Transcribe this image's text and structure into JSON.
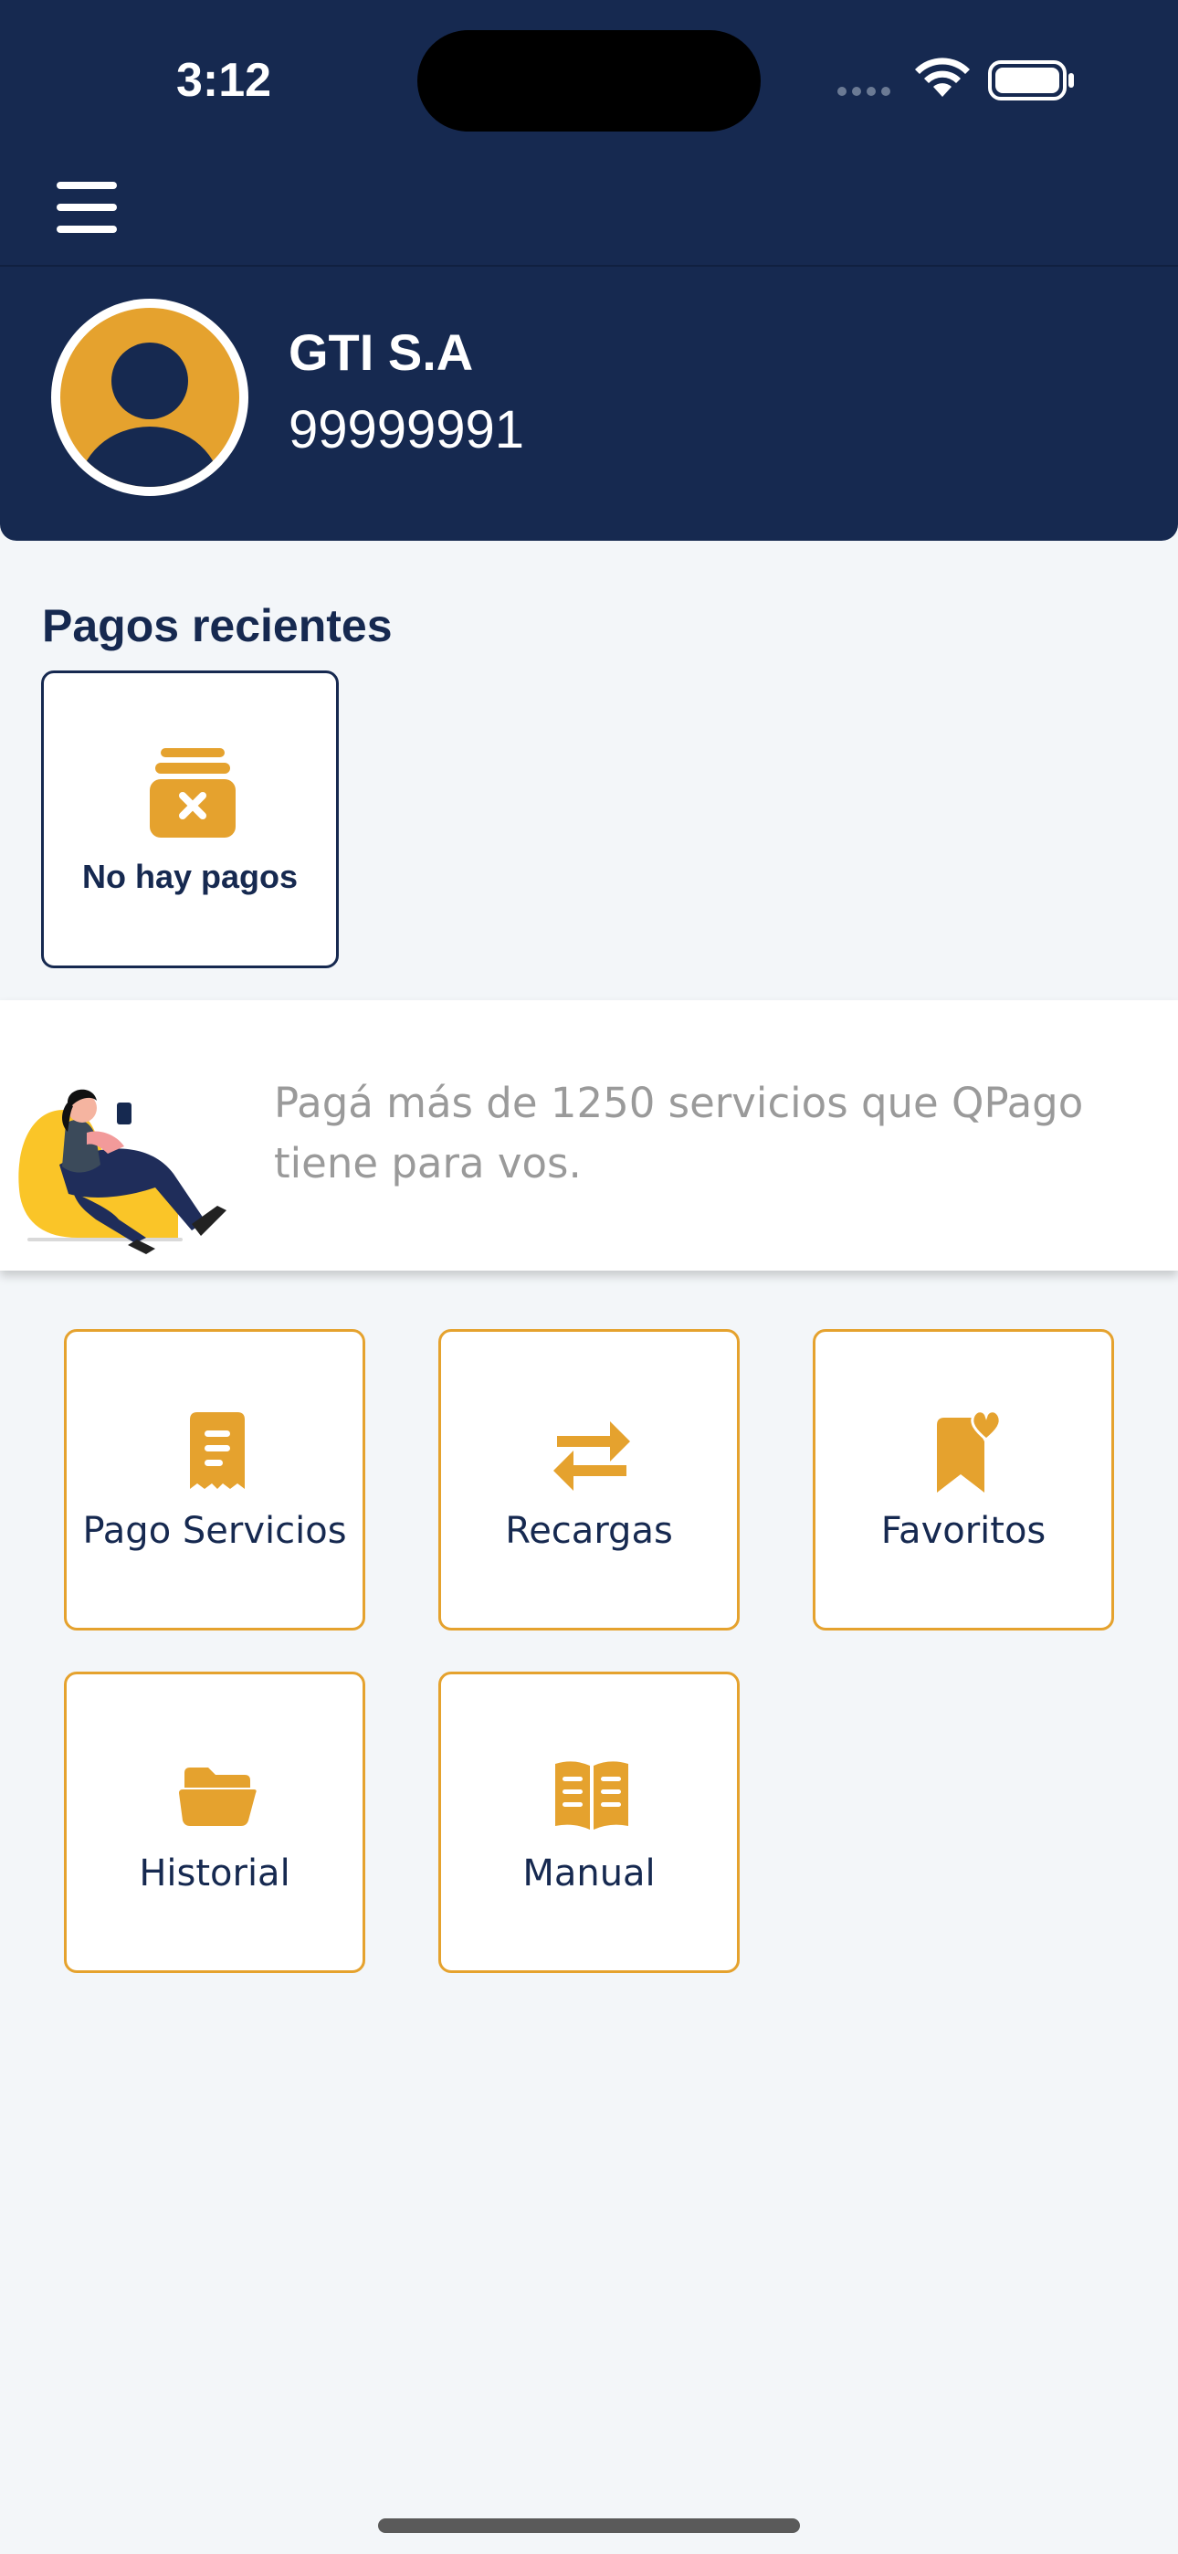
{
  "status_bar": {
    "time": "3:12"
  },
  "header": {
    "menu_icon": "hamburger-menu-icon",
    "user": {
      "name": "GTI S.A",
      "number": "99999991",
      "avatar_icon": "user-avatar-icon"
    }
  },
  "recent_payments": {
    "title": "Pagos recientes",
    "empty_label": "No hay pagos",
    "empty_icon": "archive-x-icon"
  },
  "banner": {
    "text": "Pagá más de 1250 servicios que QPago tiene para vos."
  },
  "menu": [
    {
      "label": "Pago Servicios",
      "icon": "receipt-icon"
    },
    {
      "label": "Recargas",
      "icon": "transfer-arrows-icon"
    },
    {
      "label": "Favoritos",
      "icon": "bookmark-heart-icon"
    },
    {
      "label": "Historial",
      "icon": "folder-open-icon"
    },
    {
      "label": "Manual",
      "icon": "open-book-icon"
    }
  ],
  "colors": {
    "header_bg": "#162950",
    "accent": "#e5a22e",
    "page_bg": "#f3f6f9",
    "text_dark": "#162950",
    "text_muted": "#9a9a9a"
  }
}
